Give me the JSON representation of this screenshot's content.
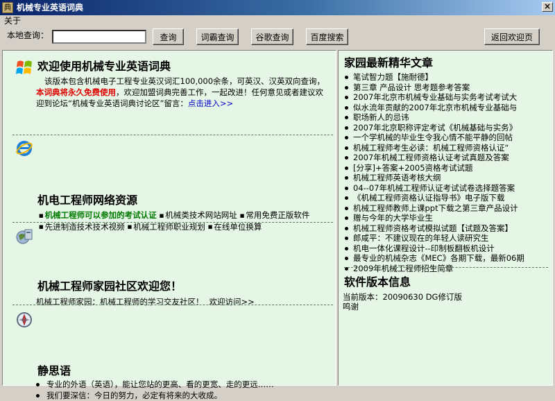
{
  "window": {
    "title": "机械专业英语词典",
    "app_icon_glyph": "典",
    "close_glyph": "×"
  },
  "menu": {
    "about": "关于"
  },
  "toolbar": {
    "search_label": "本地查询：",
    "search_value": "",
    "buttons": {
      "query": "查询",
      "ciba": "词霸查询",
      "google": "谷歌查询",
      "baidu": "百度搜索",
      "back_home": "返回欢迎页"
    }
  },
  "welcome": {
    "title": "欢迎使用机械专业英语词典",
    "intro": "该版本包含机械电子工程专业英汉词汇100,000余条，可英汉、汉英双向查询，",
    "free_notice": "本词典将永久免费使用",
    "join_text": "，欢迎加盟词典完善工作，一起改进！任何意见或者建议欢迎到论坛“机械专业英语词典讨论区”留言：",
    "enter_link": "点击进入>>"
  },
  "resources": {
    "title": "机电工程师网络资源",
    "bullet": "■",
    "links": [
      "机械工程师可以参加的考试认证",
      "机械类技术网站网址",
      "常用免费正版软件",
      "先进制造技术技术视频",
      "机械工程师职业规划",
      "在线单位换算"
    ]
  },
  "community": {
    "title": "机械工程师家园社区欢迎您！",
    "text": "机械工程师家园：机械工程师的学习交友社区！",
    "visit_link": "欢迎访问>>"
  },
  "quotes": {
    "title": "静思语",
    "items": [
      "专业的外语（英语），能让您站的更高、看的更宽、走的更远……",
      "我们要深信：今日的努力，必定有将来的大收成。"
    ]
  },
  "articles": {
    "title": "家园最新精华文章",
    "items": [
      "笔试智力题【施耐德】",
      "第三章 产品设计 思考题参考答案",
      "2007年北京市机械专业基础与实务考试考试大",
      "似水流年贡献的2007年北京市机械专业基础与",
      "职场新人的忌讳",
      "2007年北京职称评定考试《机械基础与实务》",
      "一个学机械的毕业生令我心情不能平静的回帖",
      "机械工程师考生必读：机械工程师资格认证“",
      "2007年机械工程师资格认证考试真题及答案",
      "[分享]+答案+2005资格考试试题",
      "机械工程师英语考核大纲",
      "04--07年机械工程师认证考试试卷选择题答案",
      "《机械工程师资格认证指导书》电子版下载",
      "机械工程师教师上课ppt下载之第三章产品设计",
      "赠与今年的大学毕业生",
      "机械工程师资格考试模拟试题【试题及答案】",
      "郎咸平：不建议现在的年轻人读研究生",
      "机电一体化课程设计--印制板翻板机设计",
      "最专业的机械杂志《MEC》各期下载，最新06期",
      "2009年机械工程师招生简章"
    ]
  },
  "version": {
    "title": "软件版本信息",
    "current": "当前版本：20090630 DG修订版",
    "thanks": "鸣谢"
  },
  "colors": {
    "panel_bg": "#e6f6e6",
    "titlebar_start": "#0a246a",
    "titlebar_end": "#a6caf0",
    "accent_red": "#e00000",
    "accent_green": "#007a00",
    "link_blue": "#0000cc"
  },
  "icons": {
    "welcome": "windows-logo-icon",
    "resources": "internet-explorer-icon",
    "community": "community-globe-icon",
    "quotes": "compass-icon"
  }
}
